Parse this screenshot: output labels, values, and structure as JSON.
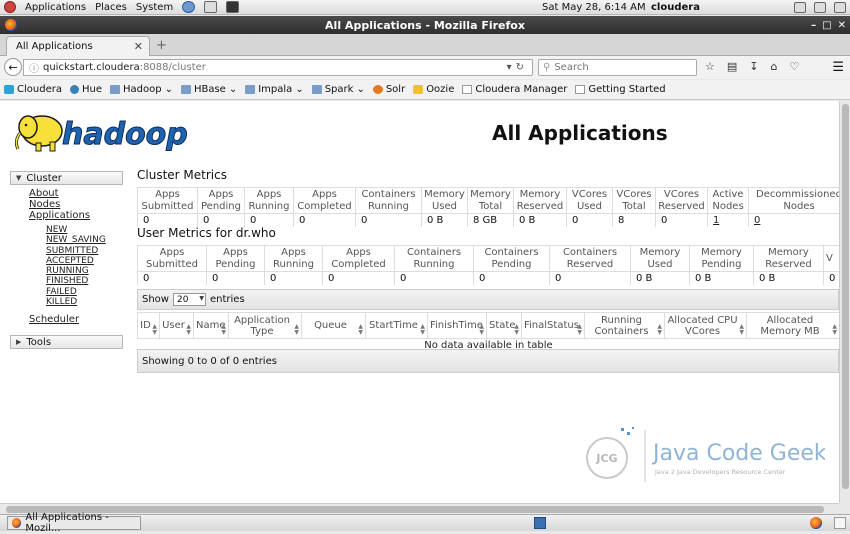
{
  "gnome_panel": {
    "menus": [
      "Applications",
      "Places",
      "System"
    ],
    "clock": "Sat May 28,  6:14 AM",
    "user": "cloudera"
  },
  "window": {
    "title": "All Applications - Mozilla Firefox"
  },
  "tab": {
    "label": "All Applications"
  },
  "nav": {
    "url_host": "quickstart.cloudera",
    "url_path": ":8088/cluster",
    "search_placeholder": "Search"
  },
  "bookmarks": [
    {
      "label": "Cloudera",
      "icon": "cdh"
    },
    {
      "label": "Hue",
      "icon": "hue"
    },
    {
      "label": "Hadoop",
      "icon": "fold",
      "caret": true
    },
    {
      "label": "HBase",
      "icon": "fold",
      "caret": true
    },
    {
      "label": "Impala",
      "icon": "fold",
      "caret": true
    },
    {
      "label": "Spark",
      "icon": "fold",
      "caret": true
    },
    {
      "label": "Solr",
      "icon": "solr"
    },
    {
      "label": "Oozie",
      "icon": "oozie"
    },
    {
      "label": "Cloudera Manager",
      "icon": "doc"
    },
    {
      "label": "Getting Started",
      "icon": "doc"
    }
  ],
  "page": {
    "title": "All Applications",
    "logo_text": "hadoop",
    "sidebar": {
      "cluster_label": "Cluster",
      "links": [
        "About",
        "Nodes",
        "Applications"
      ],
      "states": [
        "NEW",
        "NEW_SAVING",
        "SUBMITTED",
        "ACCEPTED",
        "RUNNING",
        "FINISHED",
        "FAILED",
        "KILLED"
      ],
      "scheduler": "Scheduler",
      "tools_label": "Tools"
    },
    "cluster_metrics": {
      "label": "Cluster Metrics",
      "headers": [
        "Apps Submitted",
        "Apps Pending",
        "Apps Running",
        "Apps Completed",
        "Containers Running",
        "Memory Used",
        "Memory Total",
        "Memory Reserved",
        "VCores Used",
        "VCores Total",
        "VCores Reserved",
        "Active Nodes",
        "Decommissioned Nodes"
      ],
      "values": [
        "0",
        "0",
        "0",
        "0",
        "0",
        "0 B",
        "8 GB",
        "0 B",
        "0",
        "8",
        "0",
        "1",
        "0"
      ]
    },
    "user_metrics": {
      "label": "User Metrics for dr.who",
      "headers": [
        "Apps Submitted",
        "Apps Pending",
        "Apps Running",
        "Apps Completed",
        "Containers Running",
        "Containers Pending",
        "Containers Reserved",
        "Memory Used",
        "Memory Pending",
        "Memory Reserved",
        "V"
      ],
      "values": [
        "0",
        "0",
        "0",
        "0",
        "0",
        "0",
        "0",
        "0 B",
        "0 B",
        "0 B",
        "0"
      ]
    },
    "apps_table": {
      "show_label": "Show",
      "entries_value": "20",
      "entries_label": "entries",
      "headers": [
        "ID",
        "User",
        "Name",
        "Application Type",
        "Queue",
        "StartTime",
        "FinishTime",
        "State",
        "FinalStatus",
        "Running Containers",
        "Allocated CPU VCores",
        "Allocated Memory MB"
      ],
      "empty_message": "No data available in table",
      "info": "Showing 0 to 0 of 0 entries"
    },
    "watermark": {
      "badge": "JCG",
      "name": "Java Code Geeks",
      "tagline": "Java 2 Java Developers Resource Center"
    }
  },
  "taskbar": {
    "task_label": "All Applications - Mozil..."
  }
}
